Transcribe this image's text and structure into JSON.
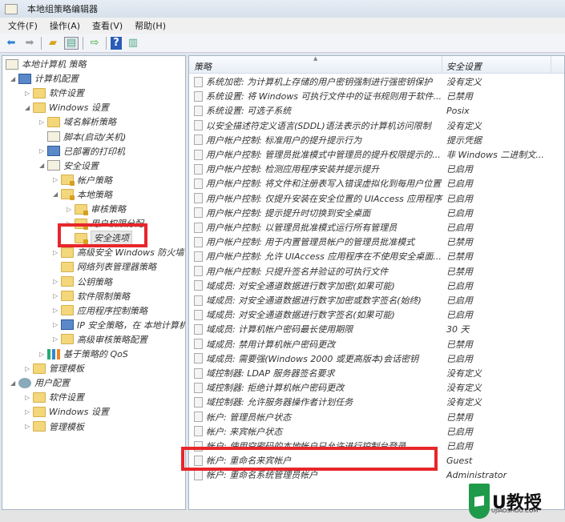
{
  "window": {
    "title": "本地组策略编辑器"
  },
  "menu": [
    "文件(F)",
    "操作(A)",
    "查看(V)",
    "帮助(H)"
  ],
  "toolbar": [
    "back-icon",
    "forward-icon",
    "up-folder-icon",
    "show-hide-tree-icon",
    "export-list-icon",
    "help-icon",
    "properties-pane-icon"
  ],
  "tree": [
    {
      "label": "本地计算机 策略",
      "level": 0,
      "icon": "doc",
      "exp": ""
    },
    {
      "label": "计算机配置",
      "level": 1,
      "icon": "pc",
      "exp": "◢"
    },
    {
      "label": "软件设置",
      "level": 2,
      "icon": "folder",
      "exp": "▷"
    },
    {
      "label": "Windows 设置",
      "level": 2,
      "icon": "folder",
      "exp": "◢"
    },
    {
      "label": "域名解析策略",
      "level": 3,
      "icon": "folder",
      "exp": "▷"
    },
    {
      "label": "脚本(启动/关机)",
      "level": 3,
      "icon": "doc",
      "exp": ""
    },
    {
      "label": "已部署的打印机",
      "level": 3,
      "icon": "pc",
      "exp": "▷"
    },
    {
      "label": "安全设置",
      "level": 3,
      "icon": "doc",
      "exp": "◢"
    },
    {
      "label": "帐户策略",
      "level": 4,
      "icon": "lockf",
      "exp": "▷"
    },
    {
      "label": "本地策略",
      "level": 4,
      "icon": "lockf",
      "exp": "◢"
    },
    {
      "label": "审核策略",
      "level": 5,
      "icon": "lockf",
      "exp": "▷"
    },
    {
      "label": "用户权限分配",
      "level": 5,
      "icon": "lockf",
      "exp": "▷"
    },
    {
      "label": "安全选项",
      "level": 5,
      "icon": "lockf",
      "exp": "",
      "selected": true
    },
    {
      "label": "高级安全 Windows 防火墙",
      "level": 4,
      "icon": "folder",
      "exp": "▷"
    },
    {
      "label": "网络列表管理器策略",
      "level": 4,
      "icon": "folder",
      "exp": ""
    },
    {
      "label": "公钥策略",
      "level": 4,
      "icon": "folder",
      "exp": "▷"
    },
    {
      "label": "软件限制策略",
      "level": 4,
      "icon": "folder",
      "exp": "▷"
    },
    {
      "label": "应用程序控制策略",
      "level": 4,
      "icon": "folder",
      "exp": "▷"
    },
    {
      "label": "IP 安全策略，在 本地计算机",
      "level": 4,
      "icon": "pc",
      "exp": "▷"
    },
    {
      "label": "高级审核策略配置",
      "level": 4,
      "icon": "folder",
      "exp": "▷"
    },
    {
      "label": "基于策略的 QoS",
      "level": 3,
      "icon": "chart",
      "exp": "▷"
    },
    {
      "label": "管理模板",
      "level": 2,
      "icon": "folder",
      "exp": "▷"
    },
    {
      "label": "用户配置",
      "level": 1,
      "icon": "user",
      "exp": "◢"
    },
    {
      "label": "软件设置",
      "level": 2,
      "icon": "folder",
      "exp": "▷"
    },
    {
      "label": "Windows 设置",
      "level": 2,
      "icon": "folder",
      "exp": "▷"
    },
    {
      "label": "管理模板",
      "level": 2,
      "icon": "folder",
      "exp": "▷"
    }
  ],
  "list": {
    "columns": [
      "策略",
      "安全设置"
    ],
    "rows": [
      [
        "系统加密: 为计算机上存储的用户密钥强制进行强密钥保护",
        "没有定义"
      ],
      [
        "系统设置: 将 Windows 可执行文件中的证书规则用于软件...",
        "已禁用"
      ],
      [
        "系统设置: 可选子系统",
        "Posix"
      ],
      [
        "以安全描述符定义语言(SDDL)语法表示的计算机访问限制",
        "没有定义"
      ],
      [
        "用户帐户控制: 标准用户的提升提示行为",
        "提示凭据"
      ],
      [
        "用户帐户控制: 管理员批准模式中管理员的提升权限提示的...",
        "非 Windows 二进制文..."
      ],
      [
        "用户帐户控制: 检测应用程序安装并提示提升",
        "已启用"
      ],
      [
        "用户帐户控制: 将文件和注册表写入错误虚拟化到每用户位置",
        "已启用"
      ],
      [
        "用户帐户控制: 仅提升安装在安全位置的 UIAccess 应用程序",
        "已启用"
      ],
      [
        "用户帐户控制: 提示提升时切换到安全桌面",
        "已启用"
      ],
      [
        "用户帐户控制: 以管理员批准模式运行所有管理员",
        "已启用"
      ],
      [
        "用户帐户控制: 用于内置管理员帐户的管理员批准模式",
        "已禁用"
      ],
      [
        "用户帐户控制: 允许 UIAccess 应用程序在不使用安全桌面...",
        "已禁用"
      ],
      [
        "用户帐户控制: 只提升签名并验证的可执行文件",
        "已禁用"
      ],
      [
        "域成员: 对安全通道数据进行数字加密(如果可能)",
        "已启用"
      ],
      [
        "域成员: 对安全通道数据进行数字加密或数字签名(始终)",
        "已启用"
      ],
      [
        "域成员: 对安全通道数据进行数字签名(如果可能)",
        "已启用"
      ],
      [
        "域成员: 计算机帐户密码最长使用期限",
        "30 天"
      ],
      [
        "域成员: 禁用计算机帐户密码更改",
        "已禁用"
      ],
      [
        "域成员: 需要强(Windows 2000 或更高版本)会话密钥",
        "已启用"
      ],
      [
        "域控制器: LDAP 服务器签名要求",
        "没有定义"
      ],
      [
        "域控制器: 拒绝计算机帐户密码更改",
        "没有定义"
      ],
      [
        "域控制器: 允许服务器操作者计划任务",
        "没有定义"
      ],
      [
        "帐户: 管理员帐户状态",
        "已禁用"
      ],
      [
        "帐户: 来宾帐户状态",
        "已启用"
      ],
      [
        "帐户: 使用空密码的本地帐户只允许进行控制台登录",
        "已启用"
      ],
      [
        "帐户: 重命名来宾帐户",
        "Guest"
      ],
      [
        "帐户: 重命名系统管理员帐户",
        "Administrator"
      ]
    ]
  },
  "watermark": {
    "brand": "U教授",
    "domain": "UJIAOSHOU.COM"
  },
  "colors": {
    "highlight": "#e8262a",
    "logo": "#1f9a4a"
  }
}
